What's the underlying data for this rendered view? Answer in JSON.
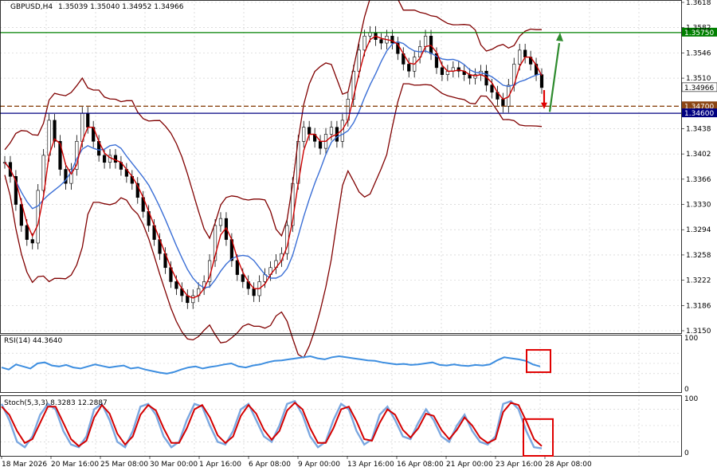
{
  "chart_data": {
    "type": "candlestick",
    "symbol_header": "GBPUSD,H4",
    "ohlc_header": "1.35039 1.35040 1.34952 1.34966",
    "main": {
      "ylim": [
        1.315,
        1.3618
      ],
      "price_axis_labels": [
        "1.3618",
        "1.3582",
        "1.3546",
        "1.3510",
        "1.3438",
        "1.3402",
        "1.3366",
        "1.3330",
        "1.3294",
        "1.3258",
        "1.3222",
        "1.3186",
        "1.3150"
      ],
      "levels": [
        {
          "value": 1.3575,
          "label": "1.35750",
          "color": "#008000",
          "style": "solid"
        },
        {
          "value": 1.347,
          "label": "1.34700",
          "color": "#8B4513",
          "style": "dashed"
        },
        {
          "value": 1.346,
          "label": "1.34600",
          "color": "#000080",
          "style": "solid"
        }
      ],
      "current_price": {
        "value": 1.34966,
        "label": "1.34966",
        "color": "#000000"
      },
      "price_series": [
        1.339,
        1.337,
        1.333,
        1.33,
        1.328,
        1.3275,
        1.335,
        1.34,
        1.345,
        1.342,
        1.338,
        1.336,
        1.338,
        1.342,
        1.346,
        1.344,
        1.342,
        1.34,
        1.339,
        1.34,
        1.339,
        1.338,
        1.337,
        1.336,
        1.334,
        1.332,
        1.33,
        1.328,
        1.326,
        1.324,
        1.322,
        1.321,
        1.32,
        1.319,
        1.32,
        1.321,
        1.322,
        1.325,
        1.33,
        1.331,
        1.328,
        1.325,
        1.323,
        1.322,
        1.321,
        1.32,
        1.322,
        1.323,
        1.324,
        1.325,
        1.326,
        1.33,
        1.336,
        1.342,
        1.344,
        1.343,
        1.342,
        1.341,
        1.343,
        1.344,
        1.342,
        1.345,
        1.348,
        1.352,
        1.355,
        1.357,
        1.3575,
        1.3565,
        1.356,
        1.357,
        1.356,
        1.3545,
        1.353,
        1.352,
        1.354,
        1.3555,
        1.357,
        1.3545,
        1.3525,
        1.3515,
        1.352,
        1.3525,
        1.352,
        1.3515,
        1.351,
        1.3515,
        1.352,
        1.35,
        1.349,
        1.348,
        1.347,
        1.35,
        1.353,
        1.355,
        1.354,
        1.353,
        1.3515,
        1.34966
      ],
      "upper_band_color": "#800000",
      "lower_band_color": "#800000",
      "ma_fast_color": "#cc0000",
      "ma_slow_color": "#3b6fd6",
      "arrows": [
        {
          "direction": "up",
          "color": "#2e8b2e"
        },
        {
          "direction": "down",
          "color": "#e00000"
        }
      ]
    },
    "rsi": {
      "label": "RSI(14) 44.3640",
      "ylim": [
        0,
        100
      ],
      "axis_labels": [
        "100",
        "0"
      ],
      "levels": [
        70,
        50,
        30
      ],
      "values": [
        42,
        38,
        48,
        44,
        40,
        50,
        52,
        46,
        44,
        47,
        42,
        40,
        44,
        48,
        45,
        42,
        44,
        46,
        40,
        42,
        38,
        35,
        32,
        30,
        33,
        38,
        42,
        44,
        40,
        43,
        45,
        48,
        50,
        44,
        42,
        46,
        48,
        52,
        55,
        56,
        58,
        60,
        62,
        64,
        60,
        58,
        62,
        64,
        62,
        60,
        58,
        56,
        55,
        52,
        50,
        48,
        49,
        47,
        48,
        50,
        52,
        47,
        46,
        48,
        46,
        45,
        47,
        46,
        48,
        56,
        62,
        60,
        58,
        55,
        48,
        44
      ],
      "color": "#3d8ee0"
    },
    "stoch": {
      "label": "Stoch(5,3,3) 8.3283 12.2887",
      "ylim": [
        0,
        100
      ],
      "axis_labels": [
        "100",
        "0"
      ],
      "levels": [
        80,
        50,
        20
      ],
      "k_values": [
        90,
        60,
        20,
        10,
        30,
        70,
        90,
        80,
        40,
        15,
        10,
        30,
        80,
        90,
        60,
        20,
        10,
        40,
        85,
        90,
        70,
        30,
        10,
        20,
        60,
        90,
        85,
        50,
        20,
        15,
        40,
        80,
        90,
        60,
        30,
        20,
        50,
        90,
        95,
        70,
        30,
        10,
        20,
        60,
        90,
        80,
        40,
        15,
        25,
        70,
        85,
        60,
        30,
        25,
        55,
        80,
        60,
        30,
        20,
        50,
        70,
        40,
        20,
        15,
        30,
        90,
        95,
        80,
        40,
        10,
        8
      ],
      "d_values": [
        85,
        70,
        40,
        18,
        25,
        55,
        85,
        85,
        55,
        25,
        12,
        22,
        65,
        88,
        72,
        35,
        15,
        30,
        70,
        88,
        78,
        45,
        18,
        18,
        45,
        80,
        88,
        65,
        32,
        18,
        30,
        68,
        88,
        72,
        42,
        24,
        40,
        78,
        92,
        80,
        45,
        18,
        18,
        45,
        80,
        85,
        58,
        25,
        22,
        55,
        80,
        70,
        42,
        28,
        45,
        72,
        68,
        42,
        25,
        42,
        65,
        50,
        28,
        18,
        25,
        75,
        92,
        88,
        58,
        25,
        12
      ],
      "k_color": "#7aa7e0",
      "d_color": "#d40000"
    },
    "x_labels": [
      "18 Mar 2026",
      "20 Mar 16:00",
      "25 Mar 08:00",
      "30 Mar 00:00",
      "1 Apr 16:00",
      "6 Apr 08:00",
      "9 Apr 00:00",
      "13 Apr 16:00",
      "16 Apr 08:00",
      "21 Apr 00:00",
      "23 Apr 16:00",
      "28 Apr 08:00"
    ]
  }
}
